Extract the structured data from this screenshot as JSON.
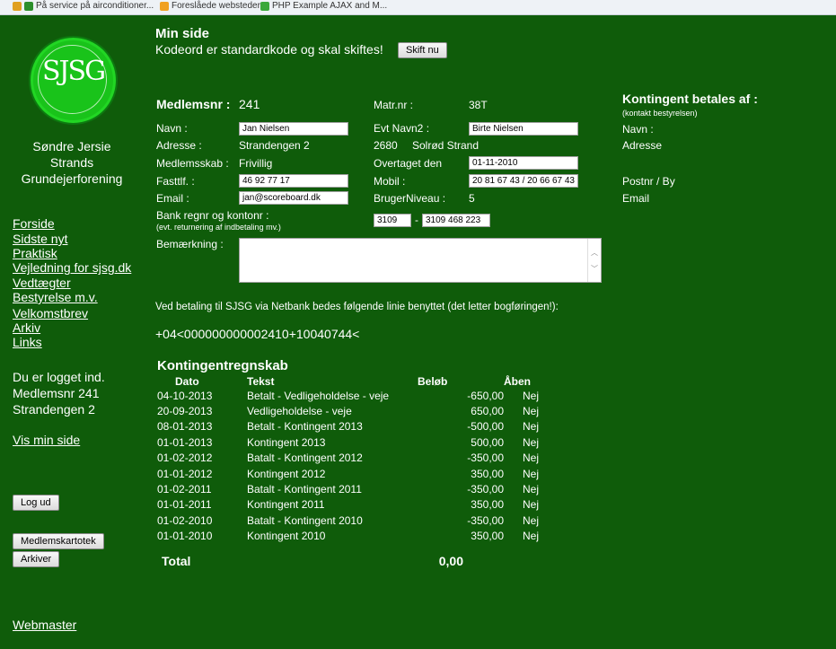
{
  "browser": {
    "bookmarks": [
      {
        "label": "På service på airconditioner...",
        "icon": "bookmark-icon",
        "color": "#2c8f2c"
      },
      {
        "label": "Foreslåede websteder",
        "icon": "suggested-sites-icon",
        "color": "#f0a020"
      },
      {
        "label": "PHP Example AJAX and M...",
        "icon": "bookmark-icon",
        "color": "#3aa83a"
      }
    ]
  },
  "sidebar": {
    "logo_text": "SJSG",
    "association": [
      "Søndre Jersie",
      "Strands",
      "Grundejerforening"
    ],
    "nav": [
      {
        "label": "Forside"
      },
      {
        "label": "Sidste nyt"
      },
      {
        "label": "Praktisk"
      },
      {
        "label": "Vejledning for sjsg.dk"
      },
      {
        "label": "Vedtægter"
      },
      {
        "label": "Bestyrelse m.v."
      },
      {
        "label": "Velkomstbrev"
      },
      {
        "label": "Arkiv"
      },
      {
        "label": "Links"
      }
    ],
    "logged_in": [
      "Du er logget ind.",
      "Medlemsnr 241",
      "Strandengen 2"
    ],
    "view_my_page": "Vis min side",
    "logout_button": "Log ud",
    "members_button": "Medlemskartotek",
    "archive_button": "Arkiver",
    "webmaster": "Webmaster"
  },
  "header": {
    "title": "Min side",
    "warning": "Kodeord er standardkode og skal skiftes!",
    "change_button": "Skift nu"
  },
  "member": {
    "number_label": "Medlemsnr :",
    "number": "241",
    "matr_label": "Matr.nr :",
    "matr": "38T",
    "name_label": "Navn :",
    "name": "Jan Nielsen",
    "name2_label": "Evt Navn2 :",
    "name2": "Birte Nielsen",
    "address_label": "Adresse :",
    "address": "Strandengen 2",
    "zip": "2680",
    "city": "Solrød Strand",
    "membership_label": "Medlemsskab :",
    "membership": "Frivillig",
    "taken_over_label": "Overtaget den",
    "taken_over": "01-11-2010",
    "phone_label": "Fasttlf. :",
    "phone": "46 92 77 17",
    "mobile_label": "Mobil :",
    "mobile": "20 81 67 43 / 20 66 67 43",
    "email_label": "Email :",
    "email": "jan@scoreboard.dk",
    "user_level_label": "BrugerNiveau :",
    "user_level": "5",
    "bank_label": "Bank regnr og kontonr :",
    "bank_note": "(evt. returnering af indbetaling mv.)",
    "bank_reg": "3109",
    "bank_dash": "-",
    "bank_account": "3109 468 223",
    "remark_label": "Bemærkning :",
    "remark": ""
  },
  "contingent_payer": {
    "title": "Kontingent betales af :",
    "note": "(kontakt bestyrelsen)",
    "name_label": "Navn :",
    "address_label": "Adresse",
    "zip_label": "Postnr / By",
    "email_label": "Email"
  },
  "netbank": {
    "text": "Ved betaling til SJSG via Netbank bedes følgende linie benyttet (det letter bogføringen!):",
    "line": "+04<000000000002410+10040744<"
  },
  "ledger": {
    "title": "Kontingentregnskab",
    "columns": [
      "Dato",
      "Tekst",
      "Beløb",
      "Åben"
    ],
    "rows": [
      [
        "04-10-2013",
        "Betalt - Vedligeholdelse - veje",
        "-650,00",
        "Nej"
      ],
      [
        "20-09-2013",
        "Vedligeholdelse - veje",
        "650,00",
        "Nej"
      ],
      [
        "08-01-2013",
        "Betalt - Kontingent 2013",
        "-500,00",
        "Nej"
      ],
      [
        "01-01-2013",
        "Kontingent 2013",
        "500,00",
        "Nej"
      ],
      [
        "01-02-2012",
        "Batalt - Kontingent 2012",
        "-350,00",
        "Nej"
      ],
      [
        "01-01-2012",
        "Kontingent 2012",
        "350,00",
        "Nej"
      ],
      [
        "01-02-2011",
        "Batalt - Kontingent 2011",
        "-350,00",
        "Nej"
      ],
      [
        "01-01-2011",
        "Kontingent 2011",
        "350,00",
        "Nej"
      ],
      [
        "01-02-2010",
        "Batalt - Kontingent 2010",
        "-350,00",
        "Nej"
      ],
      [
        "01-01-2010",
        "Kontingent 2010",
        "350,00",
        "Nej"
      ]
    ],
    "total_label": "Total",
    "total": "0,00"
  },
  "colors": {
    "background": "#0f5c0a",
    "logo_green": "#19c31a",
    "text": "#ffffff"
  }
}
